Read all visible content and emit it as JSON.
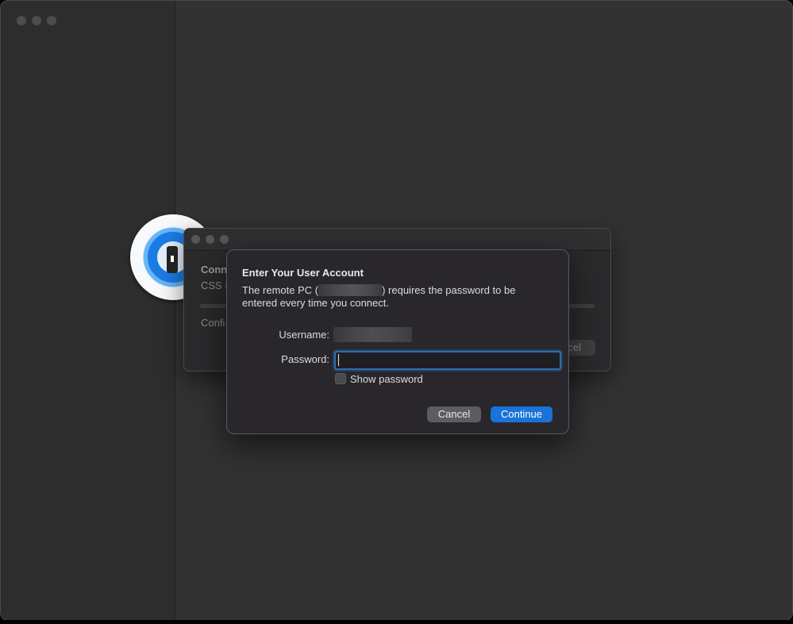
{
  "sheet": {
    "title": "Enter Your User Account",
    "message_prefix": "The remote PC (",
    "message_suffix": ") requires the password to be entered every time you connect.",
    "username_label": "Username:",
    "password_label": "Password:",
    "password_value": "",
    "show_password_label": "Show password",
    "cancel_label": "Cancel",
    "continue_label": "Continue"
  },
  "background_dialog": {
    "title": "Conn",
    "subtitle": "CSS I",
    "status": "Confi",
    "cancel_label": "cel"
  },
  "colors": {
    "accent": "#1a73d9",
    "window_bg": "#323232",
    "sheet_bg": "#29272c"
  },
  "icons": {
    "logo": "1password-logo-icon"
  }
}
